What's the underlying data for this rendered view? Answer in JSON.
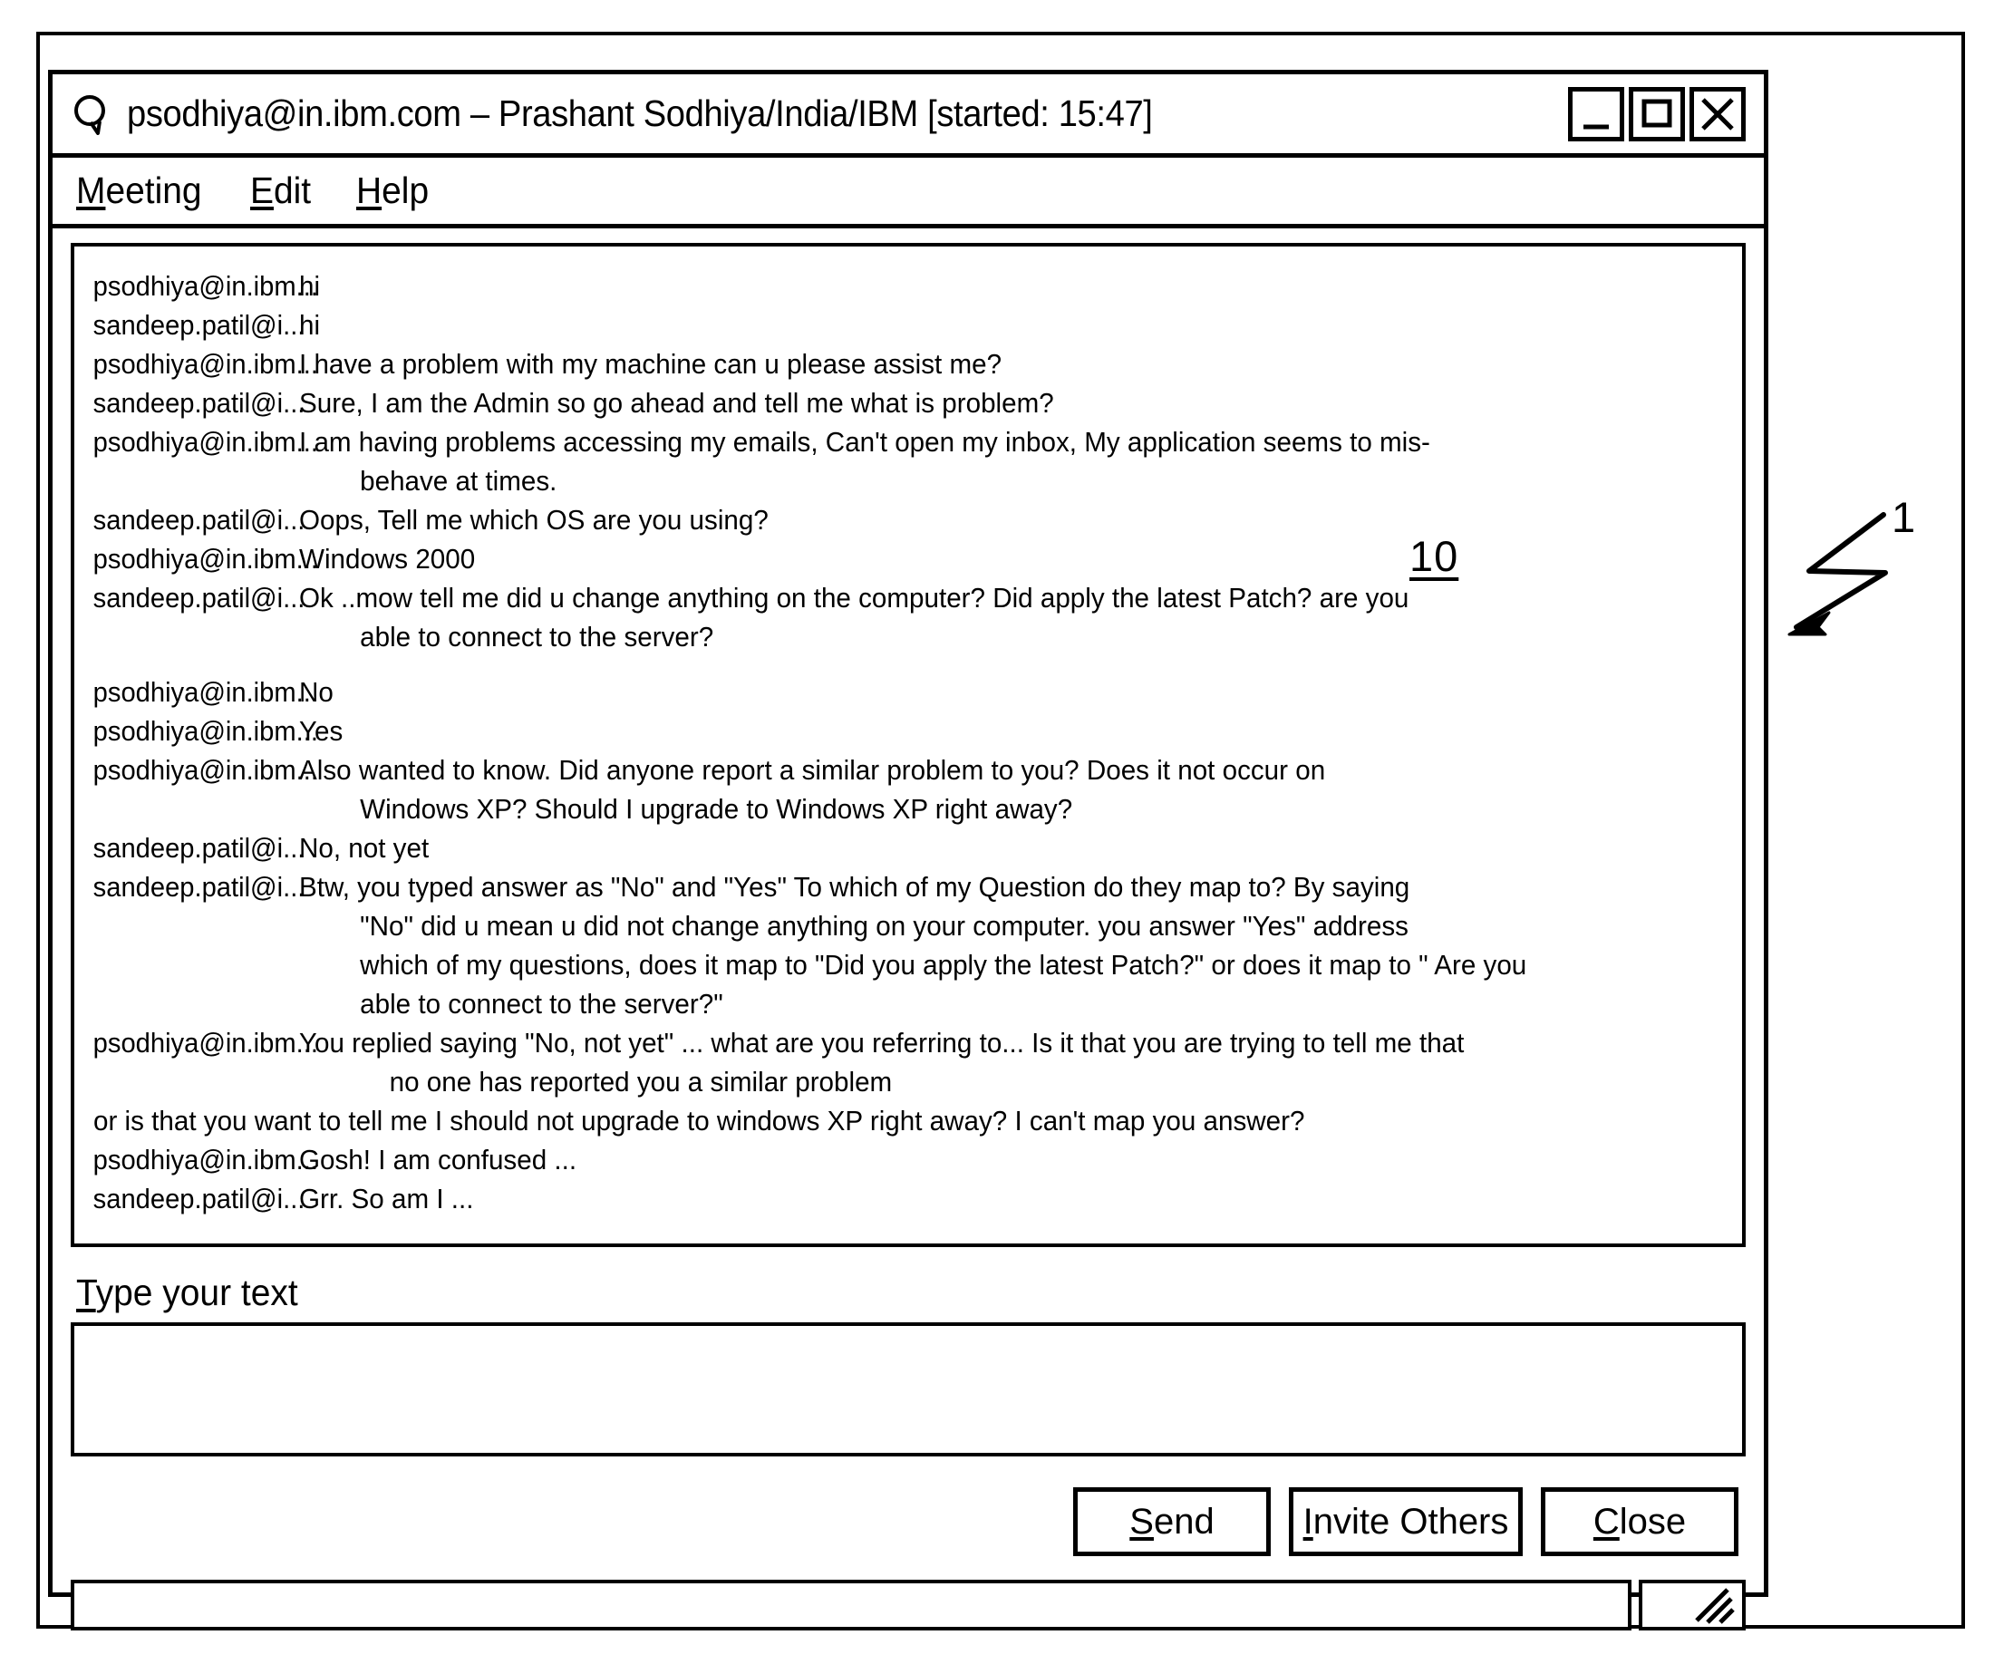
{
  "sheet": {
    "figure_ref_window": "10",
    "figure_ref_callout": "1"
  },
  "titlebar": {
    "icon": "speech-bubble-icon",
    "title": "psodhiya@in.ibm.com – Prashant Sodhiya/India/IBM [started: 15:47]",
    "controls": [
      {
        "name": "minimize-button",
        "icon": "minimize-icon"
      },
      {
        "name": "maximize-button",
        "icon": "maximize-icon"
      },
      {
        "name": "close-button",
        "icon": "close-x-icon"
      }
    ]
  },
  "menubar": {
    "items": [
      {
        "mnemonic": "M",
        "rest": "eeting"
      },
      {
        "mnemonic": "E",
        "rest": "dit"
      },
      {
        "mnemonic": "H",
        "rest": "elp"
      }
    ]
  },
  "transcript": {
    "messages": [
      {
        "type": "row",
        "user": "psodhiya@in.ibm...",
        "text": "hi"
      },
      {
        "type": "row",
        "user": "sandeep.patil@i...",
        "text": "hi"
      },
      {
        "type": "row",
        "user": "psodhiya@in.ibm...",
        "text": "I have a problem with my machine can u please assist me?"
      },
      {
        "type": "row",
        "user": "sandeep.patil@i...",
        "text": "Sure, I am the Admin so go ahead and tell me what is problem?"
      },
      {
        "type": "row",
        "user": "psodhiya@in.ibm...",
        "text": "I am having problems accessing my emails, Can't open my inbox, My application seems to mis-"
      },
      {
        "type": "cont",
        "text": "behave at times."
      },
      {
        "type": "row",
        "user": "sandeep.patil@i...",
        "text": "Oops, Tell me which OS are you using?"
      },
      {
        "type": "row",
        "user": "psodhiya@in.ibm...",
        "text": "Windows 2000"
      },
      {
        "type": "row",
        "user": "sandeep.patil@i...",
        "text": "Ok ..mow tell me did u change anything on the computer? Did apply the latest Patch? are you"
      },
      {
        "type": "cont",
        "text": "able to connect to the server?"
      },
      {
        "type": "gap"
      },
      {
        "type": "row",
        "user": "psodhiya@in.ibm...",
        "text": "No"
      },
      {
        "type": "row",
        "user": "psodhiya@in.ibm...",
        "text": "Yes"
      },
      {
        "type": "row",
        "user": "psodhiya@in.ibm...",
        "text": "Also wanted to know. Did anyone report a similar problem to you? Does it not occur on"
      },
      {
        "type": "cont",
        "text": "Windows XP? Should I upgrade to Windows XP right away?"
      },
      {
        "type": "row",
        "user": "sandeep.patil@i...",
        "text": "No, not yet"
      },
      {
        "type": "row",
        "user": "sandeep.patil@i...",
        "text": "Btw, you typed answer as \"No\" and \"Yes\" To which of my Question do they map to? By saying"
      },
      {
        "type": "cont",
        "text": "\"No\" did u mean u did not change anything on your computer. you answer \"Yes\" address"
      },
      {
        "type": "cont",
        "text": "which of my questions, does it map to \"Did you apply the latest Patch?\" or does it map to \" Are you"
      },
      {
        "type": "cont",
        "text": "able to connect to the server?\""
      },
      {
        "type": "row",
        "user": "psodhiya@in.ibm...",
        "text": "You replied saying \"No, not yet\" ... what are you referring to... Is it that you are trying to tell me that"
      },
      {
        "type": "cont-deep",
        "text": "no one has reported you a similar problem"
      },
      {
        "type": "full",
        "text": "or is that you want to tell me I should not upgrade to windows XP right away? I can't map you answer?"
      },
      {
        "type": "row",
        "user": "psodhiya@in.ibm...",
        "text": "Gosh! I am confused ..."
      },
      {
        "type": "row",
        "user": "sandeep.patil@i...",
        "text": "Grr. So am I ..."
      }
    ]
  },
  "compose": {
    "label_mnemonic": "T",
    "label_rest": "ype your text",
    "value": "",
    "placeholder": ""
  },
  "buttons": [
    {
      "name": "send-button",
      "mnemonic": "S",
      "rest": "end"
    },
    {
      "name": "invite-others-button",
      "mnemonic": "I",
      "rest": "nvite Others"
    },
    {
      "name": "close-button",
      "mnemonic": "C",
      "rest": "lose"
    }
  ],
  "statusbar": {
    "message": "",
    "grip": "resize-grip-icon"
  }
}
